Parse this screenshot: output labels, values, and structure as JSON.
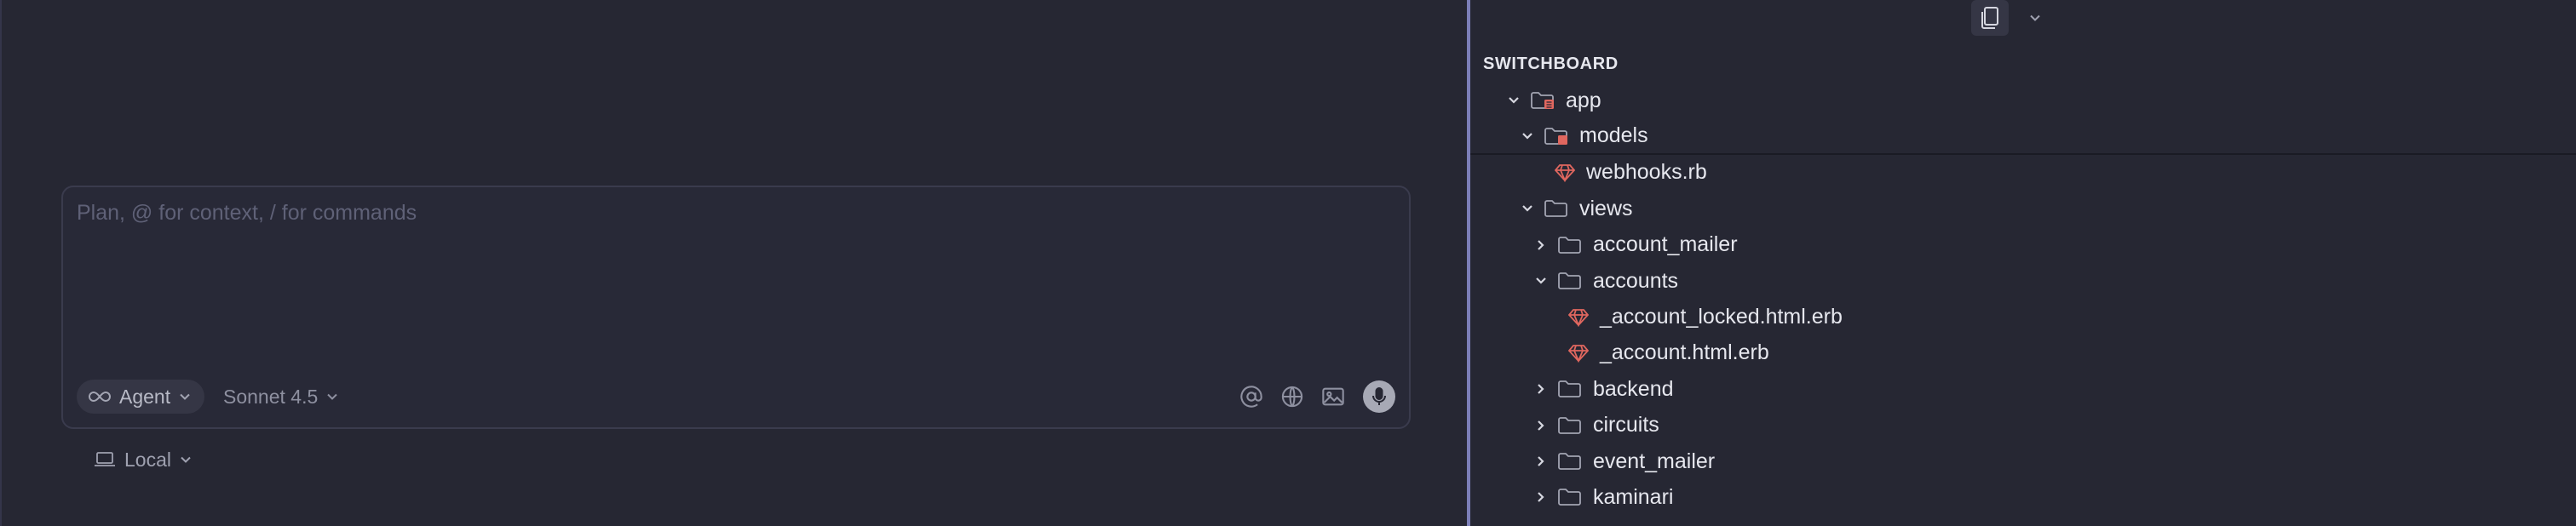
{
  "composer": {
    "placeholder": "Plan, @ for context, / for commands",
    "mode_label": "Agent",
    "model_label": "Sonnet 4.5",
    "environment_label": "Local"
  },
  "explorer": {
    "title": "SWITCHBOARD",
    "items": [
      {
        "label": "app",
        "type": "folder",
        "expanded": true
      },
      {
        "label": "models",
        "type": "folder",
        "expanded": true
      },
      {
        "label": "webhooks.rb",
        "type": "file"
      },
      {
        "label": "views",
        "type": "folder",
        "expanded": true
      },
      {
        "label": "account_mailer",
        "type": "folder",
        "expanded": false
      },
      {
        "label": "accounts",
        "type": "folder",
        "expanded": true
      },
      {
        "label": "_account_locked.html.erb",
        "type": "file"
      },
      {
        "label": "_account.html.erb",
        "type": "file"
      },
      {
        "label": "backend",
        "type": "folder",
        "expanded": false
      },
      {
        "label": "circuits",
        "type": "folder",
        "expanded": false
      },
      {
        "label": "event_mailer",
        "type": "folder",
        "expanded": false
      },
      {
        "label": "kaminari",
        "type": "folder",
        "expanded": false
      }
    ]
  },
  "colors": {
    "background": "#262733",
    "divider": "#7c7fb8",
    "ruby_icon": "#e0675f",
    "muted_text": "#8e90a0"
  }
}
